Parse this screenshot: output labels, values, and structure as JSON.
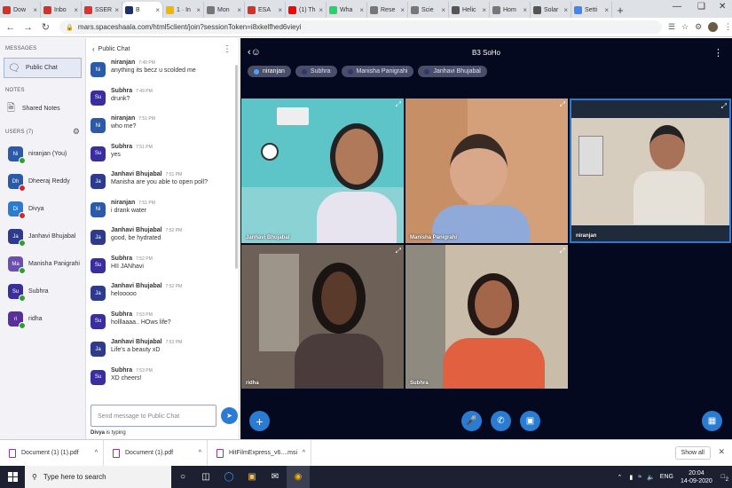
{
  "browser": {
    "tabs": [
      {
        "label": "Dow",
        "color": "#d93025"
      },
      {
        "label": "Inbo",
        "color": "#d93025"
      },
      {
        "label": "SSER",
        "color": "#e03030"
      },
      {
        "label": "B",
        "color": "#1c2f6e",
        "active": true
      },
      {
        "label": "1 · In",
        "color": "#f2b600"
      },
      {
        "label": "Mon",
        "color": "#777"
      },
      {
        "label": "ESA",
        "color": "#d93025"
      },
      {
        "label": "(1) Th",
        "color": "#ff0000"
      },
      {
        "label": "Wha",
        "color": "#25d366"
      },
      {
        "label": "Rese",
        "color": "#777"
      },
      {
        "label": "Scie",
        "color": "#777"
      },
      {
        "label": "Helic",
        "color": "#555"
      },
      {
        "label": "Hom",
        "color": "#777"
      },
      {
        "label": "Solar",
        "color": "#555"
      },
      {
        "label": "Setti",
        "color": "#4285f4"
      }
    ],
    "new_tab": "+",
    "url": "mars.spaceshaala.com/html5client/join?sessionToken=i8xkelfhed6vieyi"
  },
  "sidebar": {
    "messages_title": "MESSAGES",
    "public_chat": "Public Chat",
    "notes_title": "NOTES",
    "shared_notes": "Shared Notes",
    "users_title": "USERS (7)",
    "users": [
      {
        "initials": "Ni",
        "name": "niranjan (You)",
        "color": "#2a5aa8",
        "status": "#2ca02c"
      },
      {
        "initials": "Dh",
        "name": "Dheeraj Reddy",
        "color": "#2a5aa8",
        "status": "#d62728"
      },
      {
        "initials": "Di",
        "name": "Divya",
        "color": "#2a7cd2",
        "status": "#d62728"
      },
      {
        "initials": "Ja",
        "name": "Janhavi Bhujabal",
        "color": "#2e3a8c",
        "status": "#2ca02c"
      },
      {
        "initials": "Ma",
        "name": "Manisha Panigrahi",
        "color": "#6a4fb0",
        "status": "#2ca02c"
      },
      {
        "initials": "Su",
        "name": "Subhra",
        "color": "#3a2e9c",
        "status": "#2ca02c"
      },
      {
        "initials": "ri",
        "name": "ridha",
        "color": "#5a2e9c",
        "status": "#2ca02c"
      }
    ]
  },
  "chat": {
    "back_label": "Public Chat",
    "messages": [
      {
        "initials": "Ni",
        "name": "niranjan",
        "time": "7:49 PM",
        "text": "anything its becz u scolded me",
        "color": "#2a5aa8"
      },
      {
        "initials": "Su",
        "name": "Subhra",
        "time": "7:49 PM",
        "text": "drunk?",
        "color": "#3a2e9c"
      },
      {
        "initials": "Ni",
        "name": "niranjan",
        "time": "7:51 PM",
        "text": "who me?",
        "color": "#2a5aa8"
      },
      {
        "initials": "Su",
        "name": "Subhra",
        "time": "7:51 PM",
        "text": "yes",
        "color": "#3a2e9c"
      },
      {
        "initials": "Ja",
        "name": "Janhavi Bhujabal",
        "time": "7:51 PM",
        "text": "Manisha are you able to open poll?",
        "color": "#2e3a8c"
      },
      {
        "initials": "Ni",
        "name": "niranjan",
        "time": "7:51 PM",
        "text": "i drank water",
        "color": "#2a5aa8"
      },
      {
        "initials": "Ja",
        "name": "Janhavi Bhujabal",
        "time": "7:52 PM",
        "text": "good, be hydrated",
        "color": "#2e3a8c"
      },
      {
        "initials": "Su",
        "name": "Subhra",
        "time": "7:52 PM",
        "text": "HII JANhavi",
        "color": "#3a2e9c"
      },
      {
        "initials": "Ja",
        "name": "Janhavi Bhujabal",
        "time": "7:52 PM",
        "text": "helooooo",
        "color": "#2e3a8c"
      },
      {
        "initials": "Su",
        "name": "Subhra",
        "time": "7:53 PM",
        "text": "holllaaaa.. HOws life?",
        "color": "#3a2e9c"
      },
      {
        "initials": "Ja",
        "name": "Janhavi Bhujabal",
        "time": "7:53 PM",
        "text": "Life's a beauty xD",
        "color": "#2e3a8c"
      },
      {
        "initials": "Su",
        "name": "Subhra",
        "time": "7:53 PM",
        "text": "XD cheers!",
        "color": "#3a2e9c"
      }
    ],
    "input_placeholder": "Send message to Public Chat",
    "typing_name": "Divya",
    "typing_suffix": " is typing"
  },
  "meeting": {
    "title": "B3 SoHo",
    "talkers": [
      "niranjan",
      "Subhra",
      "Manisha Panigrahi",
      "Janhavi Bhujabal"
    ],
    "videos": [
      {
        "name": "Janhavi Bhujabal"
      },
      {
        "name": "Manisha Panigrahi"
      },
      {
        "name": "niranjan"
      },
      {
        "name": "ridha"
      },
      {
        "name": "Subhra"
      }
    ]
  },
  "downloads": {
    "items": [
      "Document (1) (1).pdf",
      "Document (1).pdf",
      "HitFilmExpress_v6....msi"
    ],
    "show_all": "Show all"
  },
  "taskbar": {
    "search_placeholder": "Type here to search",
    "lang": "ENG",
    "time": "20:04",
    "date": "14-09-2020",
    "notif_count": "2"
  }
}
